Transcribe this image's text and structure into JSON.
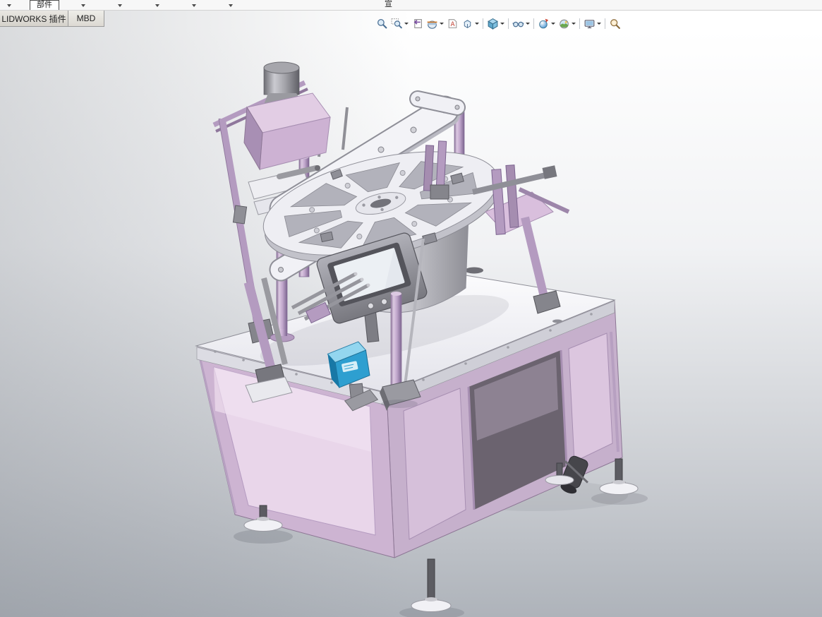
{
  "menu_bar": {
    "active_tab_label": "部件",
    "menu_item_label": "宣"
  },
  "command_manager_tabs": [
    {
      "label": "LIDWORKS 插件",
      "active": false
    },
    {
      "label": "MBD",
      "active": false
    }
  ],
  "heads_up_toolbar": {
    "icons": [
      {
        "name": "zoom-to-fit",
        "dropdown": false
      },
      {
        "name": "zoom-to-area",
        "dropdown": true
      },
      {
        "name": "previous-view",
        "dropdown": false
      },
      {
        "name": "section-view",
        "dropdown": true
      },
      {
        "name": "annotation-view",
        "dropdown": false
      },
      {
        "name": "view-orientation",
        "dropdown": true
      },
      {
        "name": "display-style",
        "dropdown": true
      },
      {
        "name": "hide-show-items",
        "dropdown": true
      },
      {
        "name": "edit-appearance",
        "dropdown": true
      },
      {
        "name": "apply-scene",
        "dropdown": true
      },
      {
        "name": "view-settings",
        "dropdown": true
      },
      {
        "name": "magnifier",
        "dropdown": false
      }
    ]
  },
  "viewport": {
    "background_top_color": "#ffffff",
    "background_bottom_color": "#aeb3ba",
    "model_palette": {
      "lavender": "#c9afd3",
      "panel_pink": "#e8d4e9",
      "white_plate": "#f3f3f7",
      "metal_gray": "#a9a9af",
      "dark_gray": "#5f5f66",
      "accent_blue": "#2e9fd0"
    }
  }
}
